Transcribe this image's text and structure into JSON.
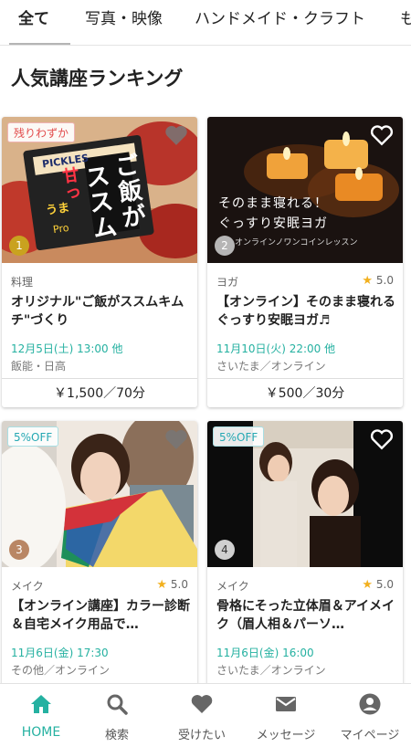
{
  "tabs": [
    "全て",
    "写真・映像",
    "ハンドメイド・クラフト",
    "も"
  ],
  "section_title": "人気講座ランキング",
  "cards": [
    {
      "rank": "1",
      "tag": "残りわずか",
      "image_text": [
        "ご飯が",
        "ススム",
        "甘っ",
        "うま",
        "PICKLES",
        "Pro"
      ],
      "category": "料理",
      "rating": "",
      "title": "オリジナル\"ご飯がススムキムチ\"づくり",
      "date": "12月5日(土) 13:00 他",
      "location": "飯能・日高",
      "price": "￥1,500／70分"
    },
    {
      "rank": "2",
      "tag": "",
      "image_text": [
        "そのまま寝れる！",
        "ぐっすり安眠ヨガ",
        "オンラインノワンコインレッスン"
      ],
      "category": "ヨガ",
      "rating": "5.0",
      "title": "【オンライン】そのまま寝れるぐっすり安眠ヨガ♬",
      "date": "11月10日(火) 22:00 他",
      "location": "さいたま／オンライン",
      "price": "￥500／30分"
    },
    {
      "rank": "3",
      "tag": "5%OFF",
      "image_text": [],
      "category": "メイク",
      "rating": "5.0",
      "title": "【オンライン講座】カラー診断＆自宅メイク用品で…",
      "date": "11月6日(金) 17:30",
      "location": "その他／オンライン",
      "price": ""
    },
    {
      "rank": "4",
      "tag": "5%OFF",
      "image_text": [],
      "category": "メイク",
      "rating": "5.0",
      "title": "骨格にそった立体眉＆アイメイク（眉人相＆パーソ…",
      "date": "11月6日(金) 16:00",
      "location": "さいたま／オンライン",
      "price": ""
    }
  ],
  "nav": [
    {
      "label": "HOME",
      "icon": "home-icon"
    },
    {
      "label": "検索",
      "icon": "search-icon"
    },
    {
      "label": "受けたい",
      "icon": "heart-icon"
    },
    {
      "label": "メッセージ",
      "icon": "envelope-icon"
    },
    {
      "label": "マイページ",
      "icon": "user-icon"
    }
  ],
  "colors": {
    "accent": "#25b1a1",
    "star": "#f2b01e",
    "sale_tag": "#25a8b3",
    "limited_tag": "#e24c4c"
  }
}
